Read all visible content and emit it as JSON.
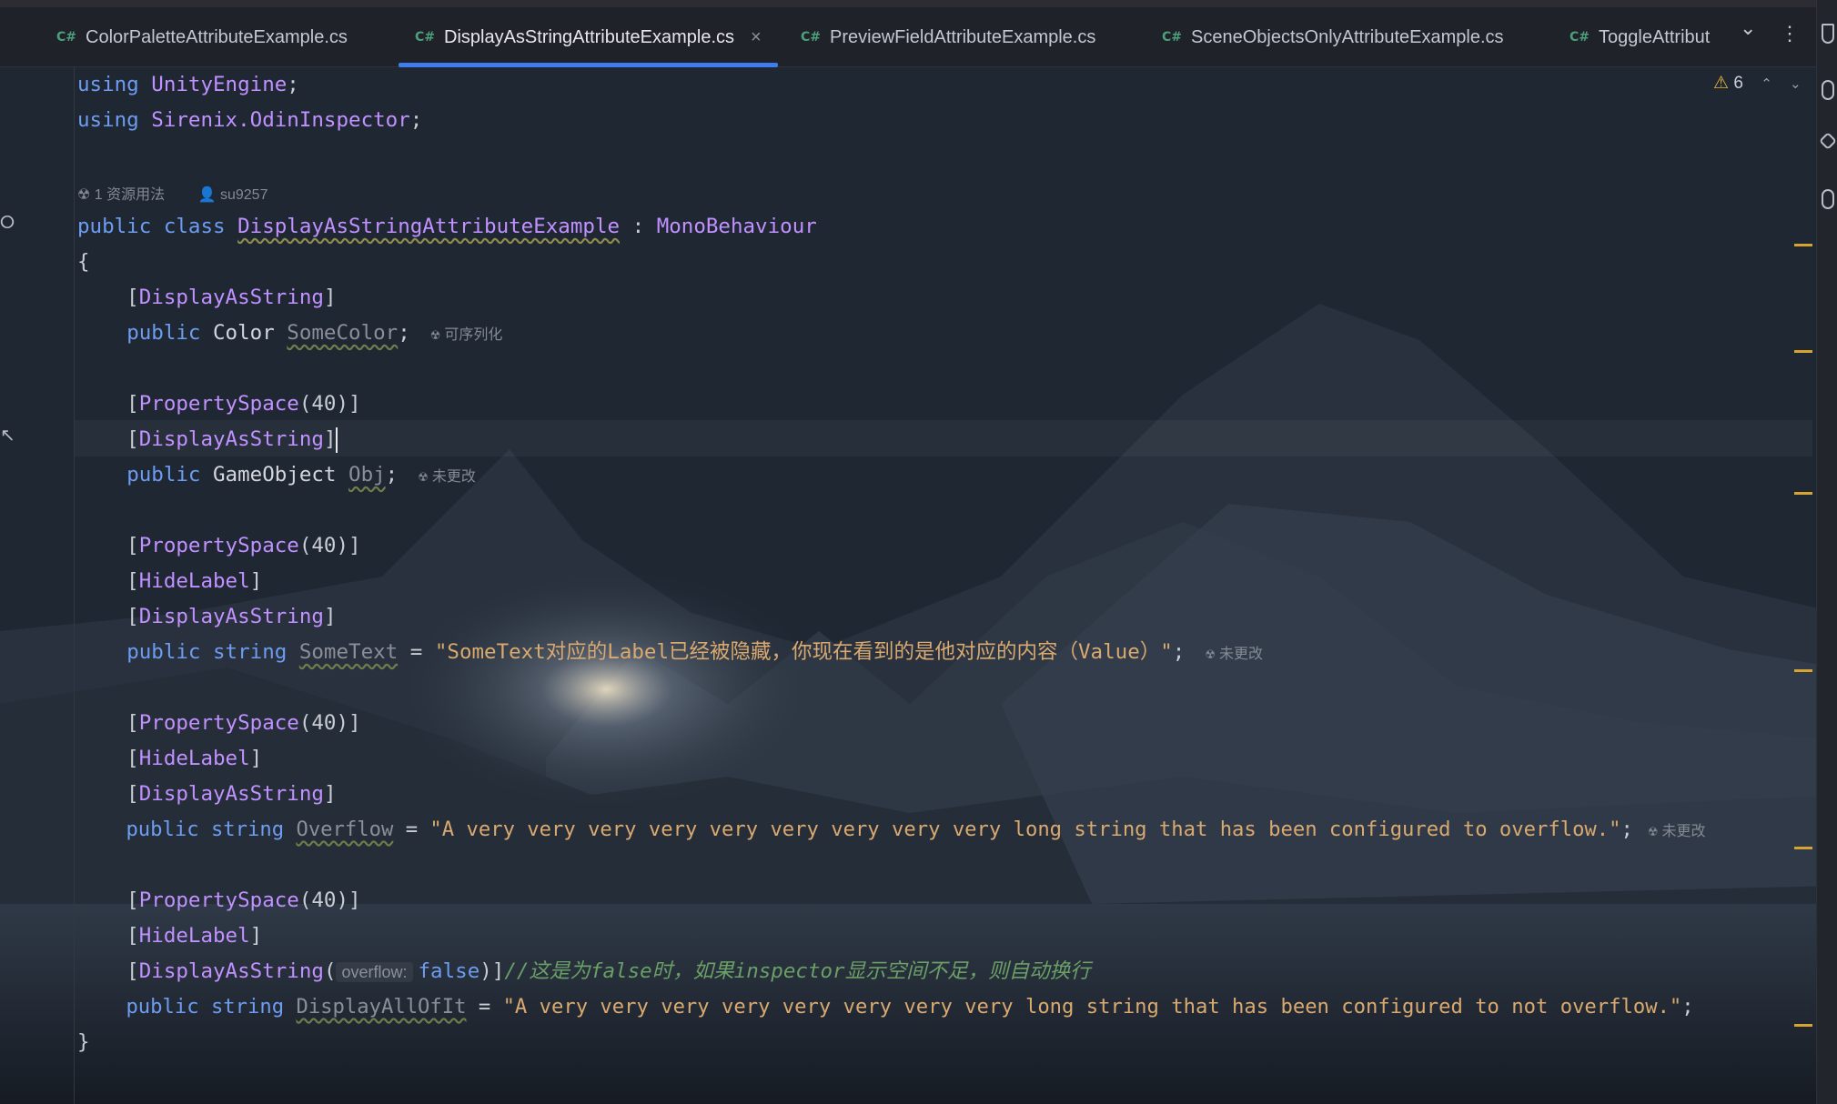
{
  "tabs": [
    {
      "icon": "C#",
      "label": "ColorPaletteAttributeExample.cs",
      "active": false
    },
    {
      "icon": "C#",
      "label": "DisplayAsStringAttributeExample.cs",
      "active": true,
      "close": "×"
    },
    {
      "icon": "C#",
      "label": "PreviewFieldAttributeExample.cs",
      "active": false
    },
    {
      "icon": "C#",
      "label": "SceneObjectsOnlyAttributeExample.cs",
      "active": false
    },
    {
      "icon": "C#",
      "label": "ToggleAttribut",
      "active": false
    }
  ],
  "tab_controls": {
    "more": "⌄",
    "menu": "⋮"
  },
  "warnings": {
    "icon": "⚠",
    "count": "6",
    "up": "⌃",
    "down": "⌄"
  },
  "codelens": {
    "usages": "1 资源用法",
    "author": "su9257"
  },
  "inlay": {
    "serializable": "可序列化",
    "unchanged": "未更改"
  },
  "code": {
    "l1_kw": "using",
    "l1_ns": "UnityEngine",
    "l2_kw": "using",
    "l2_ns": "Sirenix.OdinInspector",
    "class_mods": "public class",
    "class_name": "DisplayAsStringAttributeExample",
    "base": "MonoBehaviour",
    "brace_open": "{",
    "attr_das": "DisplayAsString",
    "attr_ps": "PropertySpace",
    "attr_ps_arg": "40",
    "attr_hl": "HideLabel",
    "public": "public",
    "t_color": "Color",
    "f_somecolor": "SomeColor",
    "t_go": "GameObject",
    "f_obj": "Obj",
    "t_string": "string",
    "f_sometext": "SomeText",
    "v_sometext": "\"SomeText对应的Label已经被隐藏，你现在看到的是他对应的内容（Value）\"",
    "f_overflow": "Overflow",
    "v_overflow": "\"A very very very very very very very very very long string that has been configured to overflow.\"",
    "param_hint": "overflow:",
    "v_false": "false",
    "comment": "//这是为false时，如果inspector显示空间不足，则自动换行",
    "f_displayall": "DisplayAllOfIt",
    "v_displayall": "\"A very very very very very very very very long string that has been configured to not overflow.\"",
    "brace_close": "}"
  },
  "colors": {
    "accent": "#3d7df0",
    "keyword": "#6d9cf0",
    "type": "#c191ff",
    "string": "#d9a96f",
    "comment": "#6a9f67",
    "warning": "#e8b339"
  }
}
